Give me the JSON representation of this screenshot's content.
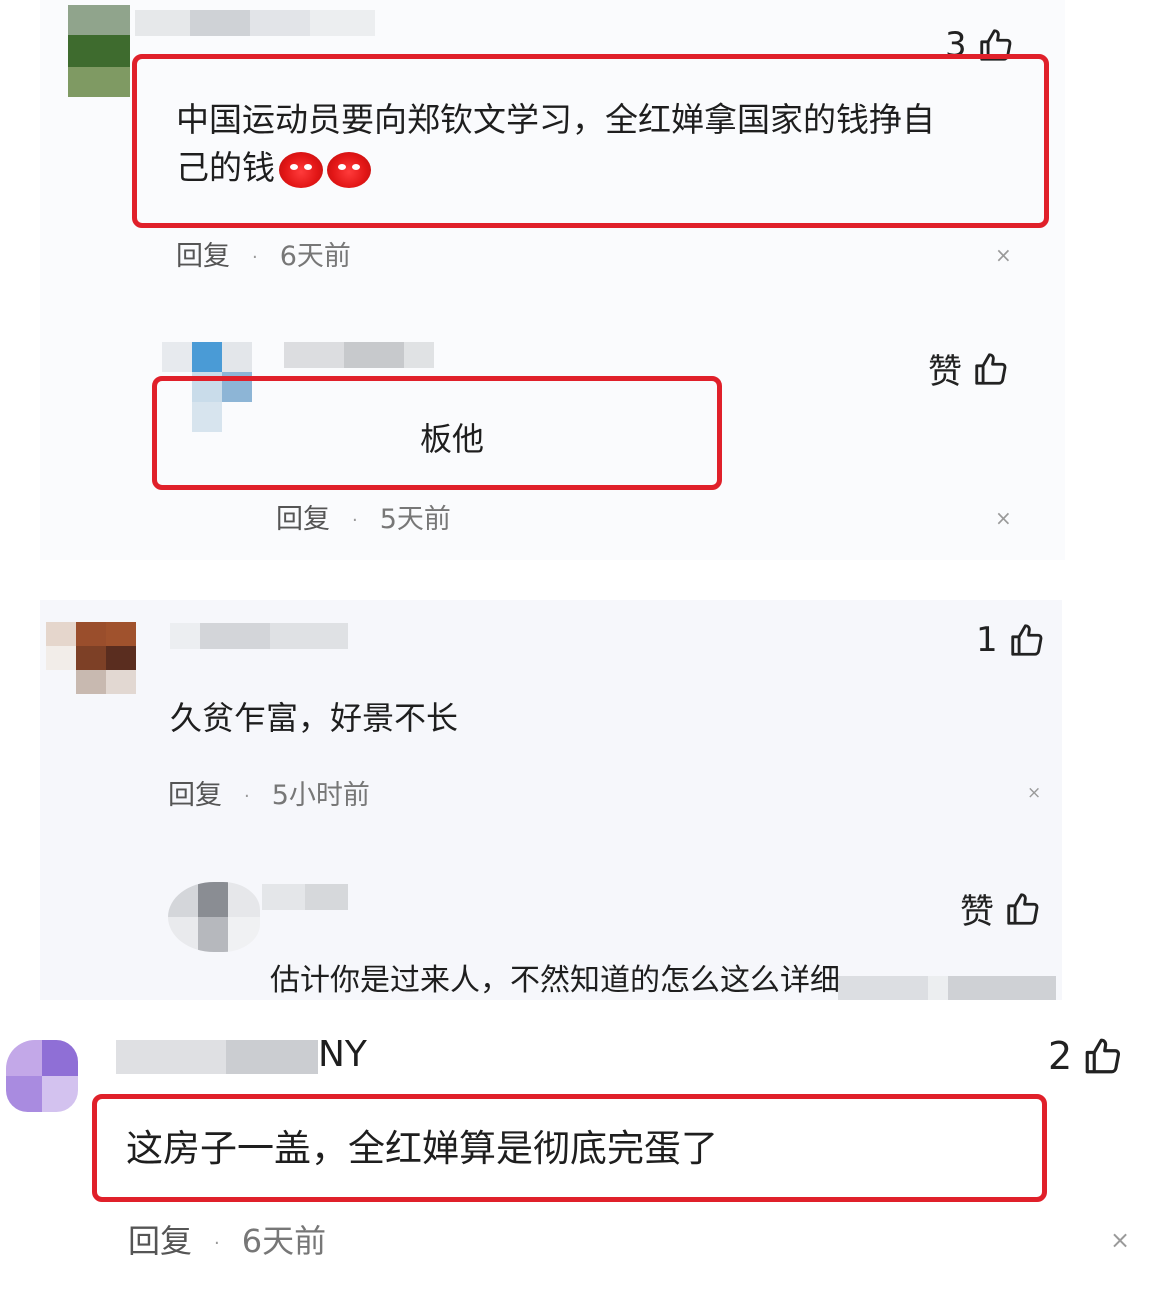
{
  "comments": [
    {
      "likes": "3",
      "text_line1": "中国运动员要向郑钦文学习，全红婵拿国家的钱挣自",
      "text_line2": "己的钱",
      "reply_label": "回复",
      "time": "6天前",
      "emoji_icon": "devil-emoji-icon",
      "reply": {
        "likes": "赞",
        "text": "板他",
        "reply_label": "回复",
        "time": "5天前"
      }
    },
    {
      "likes": "1",
      "text": "久贫乍富，好景不长",
      "reply_label": "回复",
      "time": "5小时前",
      "reply": {
        "likes": "赞",
        "text": "估计你是过来人，不然知道的怎么这么详细"
      }
    },
    {
      "name_visible": "NY",
      "likes": "2",
      "text": "这房子一盖，全红婵算是彻底完蛋了",
      "reply_label": "回复",
      "time": "6天前"
    }
  ],
  "close_glyph": "×",
  "dot_glyph": "·",
  "colors": {
    "highlight": "#e0202a",
    "panel_light": "#fafbfd",
    "panel_grey": "#f6f7fb"
  }
}
